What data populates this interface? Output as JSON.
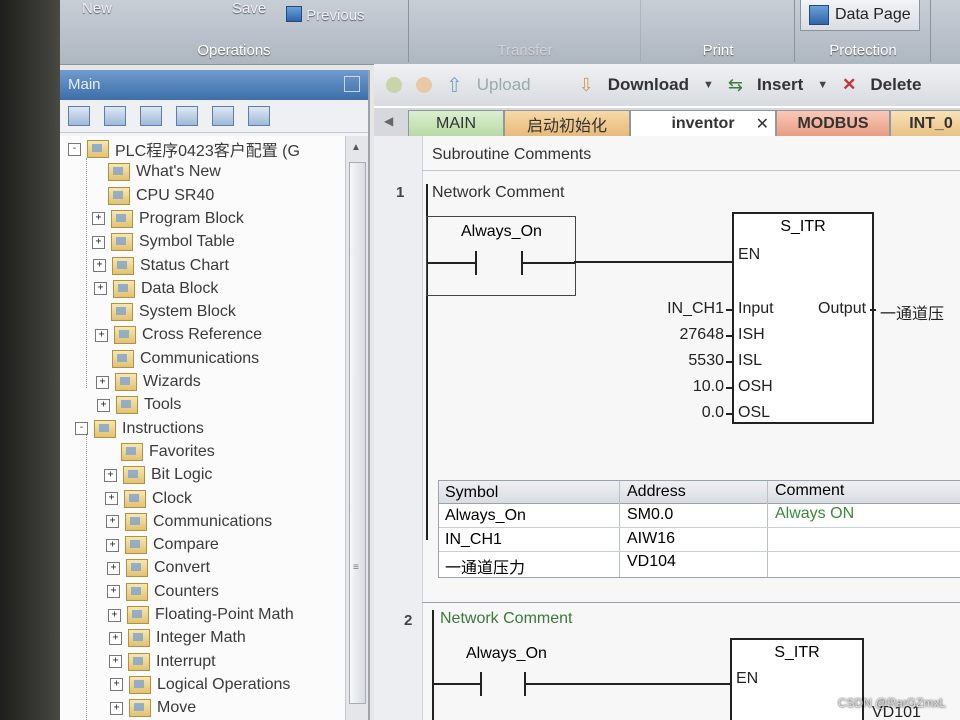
{
  "ribbon": {
    "groups": [
      {
        "label": "Operations"
      },
      {
        "label": "Transfer"
      },
      {
        "label": "Print"
      },
      {
        "label": "Protection"
      }
    ],
    "buttons": {
      "new": "New",
      "save": "Save",
      "previous": "Previous",
      "data_page": "Data Page"
    }
  },
  "panel": {
    "title": "Main",
    "tree": [
      {
        "label": "PLC程序0423客户配置 (G",
        "level": 0,
        "expander": "-"
      },
      {
        "label": "What's New",
        "level": 1,
        "expander": ""
      },
      {
        "label": "CPU SR40",
        "level": 1,
        "expander": ""
      },
      {
        "label": "Program Block",
        "level": 1,
        "expander": "+"
      },
      {
        "label": "Symbol Table",
        "level": 1,
        "expander": "+"
      },
      {
        "label": "Status Chart",
        "level": 1,
        "expander": "+"
      },
      {
        "label": "Data Block",
        "level": 1,
        "expander": "+"
      },
      {
        "label": "System Block",
        "level": 1,
        "expander": ""
      },
      {
        "label": "Cross Reference",
        "level": 1,
        "expander": "+"
      },
      {
        "label": "Communications",
        "level": 1,
        "expander": ""
      },
      {
        "label": "Wizards",
        "level": 1,
        "expander": "+"
      },
      {
        "label": "Tools",
        "level": 1,
        "expander": "+"
      },
      {
        "label": "Instructions",
        "level": 0,
        "expander": "-"
      },
      {
        "label": "Favorites",
        "level": 1,
        "expander": ""
      },
      {
        "label": "Bit Logic",
        "level": 1,
        "expander": "+"
      },
      {
        "label": "Clock",
        "level": 1,
        "expander": "+"
      },
      {
        "label": "Communications",
        "level": 1,
        "expander": "+"
      },
      {
        "label": "Compare",
        "level": 1,
        "expander": "+"
      },
      {
        "label": "Convert",
        "level": 1,
        "expander": "+"
      },
      {
        "label": "Counters",
        "level": 1,
        "expander": "+"
      },
      {
        "label": "Floating-Point Math",
        "level": 1,
        "expander": "+"
      },
      {
        "label": "Integer Math",
        "level": 1,
        "expander": "+"
      },
      {
        "label": "Interrupt",
        "level": 1,
        "expander": "+"
      },
      {
        "label": "Logical Operations",
        "level": 1,
        "expander": "+"
      },
      {
        "label": "Move",
        "level": 1,
        "expander": "+"
      }
    ]
  },
  "editor": {
    "toolbar": {
      "upload": "Upload",
      "download": "Download",
      "insert": "Insert",
      "delete": "Delete"
    },
    "tabs": [
      "MAIN",
      "启动初始化",
      "inventor",
      "MODBUS",
      "INT_0"
    ],
    "subroutine_comments": "Subroutine Comments",
    "networks": [
      {
        "number": "1",
        "comment": "Network Comment",
        "contact": "Always_On",
        "block": {
          "name": "S_ITR",
          "en": "EN",
          "inputs": [
            {
              "value": "IN_CH1",
              "pin": "Input"
            },
            {
              "value": "27648",
              "pin": "ISH"
            },
            {
              "value": "5530",
              "pin": "ISL"
            },
            {
              "value": "10.0",
              "pin": "OSH"
            },
            {
              "value": "0.0",
              "pin": "OSL"
            }
          ],
          "output_pin": "Output",
          "output_value": "一通道压"
        },
        "symbols": {
          "headers": [
            "Symbol",
            "Address",
            "Comment"
          ],
          "rows": [
            [
              "Always_On",
              "SM0.0",
              "Always ON"
            ],
            [
              "IN_CH1",
              "AIW16",
              ""
            ],
            [
              "一通道压力",
              "VD104",
              ""
            ]
          ]
        }
      },
      {
        "number": "2",
        "comment": "Network Comment",
        "contact": "Always_On",
        "block": {
          "name": "S_ITR",
          "en": "EN",
          "output_value": "VD101"
        }
      }
    ]
  },
  "watermark": "CSDN @RarGZmxL"
}
